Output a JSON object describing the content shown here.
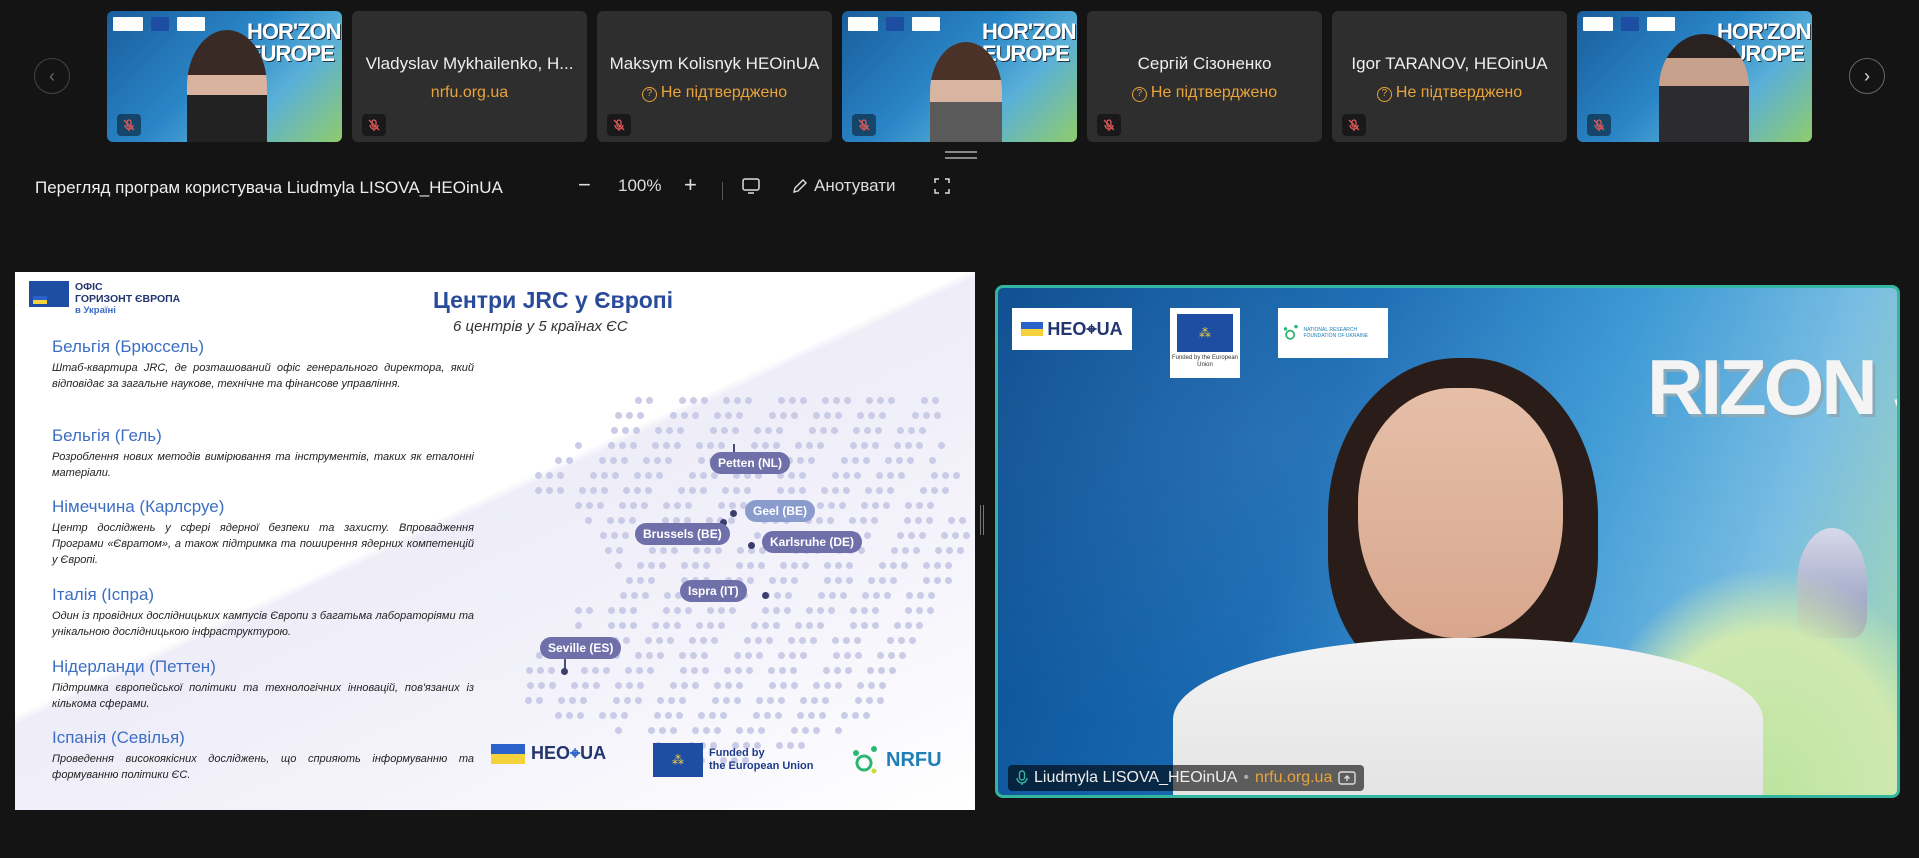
{
  "strip": {
    "tiles": [
      {
        "kind": "video",
        "name": "",
        "subtitle": ""
      },
      {
        "kind": "text",
        "name": "Vladyslav Mykhailenko, H...",
        "subtitle": "nrfu.org.ua"
      },
      {
        "kind": "text",
        "name": "Maksym Kolisnyk HEOinUA",
        "subtitle": "Не підтверджено"
      },
      {
        "kind": "video",
        "name": "",
        "subtitle": ""
      },
      {
        "kind": "text",
        "name": "Сергій Сізоненко",
        "subtitle": "Не підтверджено"
      },
      {
        "kind": "text",
        "name": "Igor  TARANOV, HEOinUA",
        "subtitle": "Не підтверджено"
      },
      {
        "kind": "video",
        "name": "",
        "subtitle": ""
      }
    ],
    "banner_text": "HORIZON EUROPE"
  },
  "toolbar": {
    "title": "Перегляд програм користувача Liudmyla LISOVA_HEOinUA",
    "zoom": "100%",
    "annotate": "Анотувати"
  },
  "slide": {
    "logo_line1": "ОФІС",
    "logo_line2": "ГОРИЗОНТ ЄВРОПА",
    "logo_line3": "в Україні",
    "title": "Центри JRC у Європі",
    "subtitle": "6 центрів у 5 країнах ЄС",
    "items": [
      {
        "heading": "Бельгія (Брюссель)",
        "text": "Штаб-квартира JRC, де розташований офіс генерального директора, який відповідає за загальне наукове, технічне та фінансове управління."
      },
      {
        "heading": "Бельгія (Гель)",
        "text": "Розроблення нових методів вимірювання та інструментів, таких як еталонні матеріали."
      },
      {
        "heading": "Німеччина (Карлсруе)",
        "text": "Центр досліджень у сфері ядерної безпеки та захисту. Впровадження Програми «Євратом», а також підтримка та поширення ядерних компетенцій у Європі."
      },
      {
        "heading": "Італія (Іспра)",
        "text": "Один із провідних дослідницьких кампусів Європи з багатьма лабораторіями та унікальною дослідницькою інфраструктурою."
      },
      {
        "heading": "Нідерланди (Петтен)",
        "text": "Підтримка європейської політики та технологічних інновацій, пов'язаних із кількома сферами."
      },
      {
        "heading": "Іспанія (Севілья)",
        "text": "Проведення високоякісних досліджень, що сприяють інформуванню та формуванню політики ЄС."
      }
    ],
    "pins": [
      "Petten (NL)",
      "Geel (BE)",
      "Brussels (BE)",
      "Karlsruhe (DE)",
      "Ispra (IT)",
      "Seville (ES)"
    ],
    "footer": {
      "heo": "HEO",
      "ua": "UA",
      "funded1": "Funded by",
      "funded2": "the European Union",
      "nrfu": "NRFU"
    }
  },
  "speaker": {
    "name": "Liudmyla LISOVA_HEOinUA",
    "org": "nrfu.org.ua",
    "logo_heo": "HEO",
    "logo_ua": "UA",
    "logo_funded": "Funded by the European Union",
    "logo_nrf": "NATIONAL RESEARCH FOUNDATION OF UKRAINE",
    "banner": "RIZON JROPE"
  },
  "colors": {
    "accent": "#33b5a0",
    "warning": "#e8a33a",
    "slide_blue": "#3c6ec4"
  }
}
